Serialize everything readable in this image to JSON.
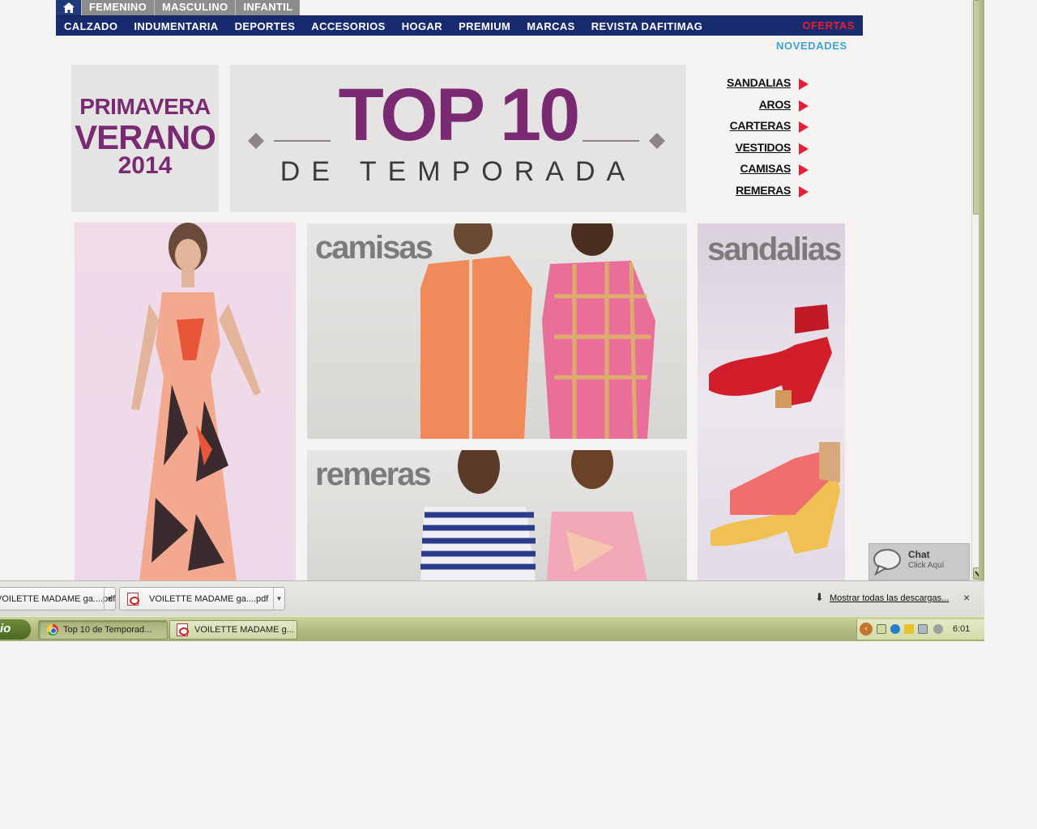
{
  "gender_tabs": {
    "home_icon": "home-icon",
    "items": [
      "FEMENINO",
      "MASCULINO",
      "INFANTIL"
    ]
  },
  "nav": {
    "items": [
      "CALZADO",
      "INDUMENTARIA",
      "DEPORTES",
      "ACCESORIOS",
      "HOGAR",
      "PREMIUM",
      "MARCAS",
      "REVISTA DAFITIMAG"
    ],
    "ofertas": "OFERTAS",
    "novedades": "NOVEDADES"
  },
  "season_badge": {
    "line1": "PRIMAVERA",
    "line2": "VERANO",
    "line3": "2014"
  },
  "banner": {
    "title": "TOP 10",
    "subtitle": "DE TEMPORADA"
  },
  "categories": [
    "SANDALIAS",
    "AROS",
    "CARTERAS",
    "VESTIDOS",
    "CAMISAS",
    "REMERAS"
  ],
  "tiles": {
    "camisas": "camisas",
    "remeras": "remeras",
    "sandalias": "sandalias"
  },
  "chat": {
    "title": "Chat",
    "subtitle": "Click Aquí",
    "icon": "speech-bubble-icon"
  },
  "downloads": {
    "items": [
      "VOILETTE MADAME ga....pdf",
      "VOILETTE MADAME ga....pdf"
    ],
    "show_all": "Mostrar todas las descargas...",
    "close": "×"
  },
  "taskbar": {
    "start_label": "io",
    "tasks": [
      "Top 10 de Temporad...",
      "VOILETTE MADAME g..."
    ],
    "clock": "6:01"
  },
  "colors": {
    "nav_bg": "#182b6e",
    "brand_purple": "#7a2a72",
    "ofertas_red": "#e8202e",
    "novedades_blue": "#3aa3cf",
    "arrow_red": "#e2203a"
  }
}
